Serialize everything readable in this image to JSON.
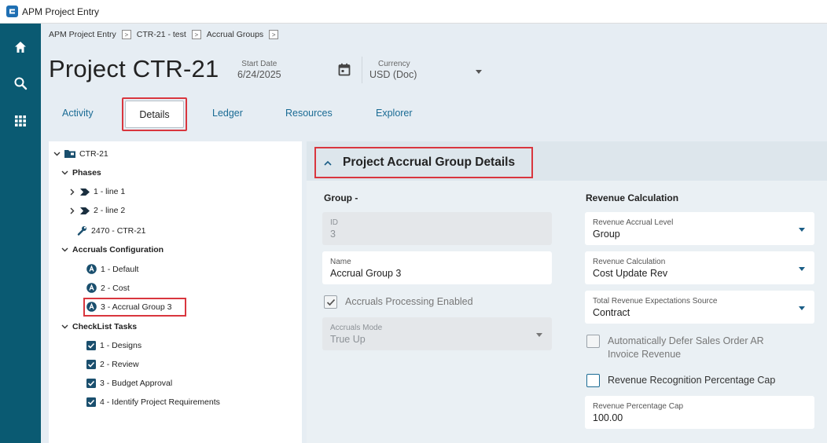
{
  "window": {
    "title": "APM Project Entry"
  },
  "nav": {
    "icons": [
      "home-icon",
      "search-icon",
      "apps-grid-icon"
    ]
  },
  "breadcrumb": [
    "APM Project Entry",
    "CTR-21 - test",
    "Accrual Groups"
  ],
  "page": {
    "title": "Project CTR-21",
    "start_date_label": "Start Date",
    "start_date_value": "6/24/2025",
    "currency_label": "Currency",
    "currency_value": "USD (Doc)"
  },
  "tabs": [
    "Activity",
    "Details",
    "Ledger",
    "Resources",
    "Explorer"
  ],
  "active_tab": "Details",
  "tree": {
    "root": "CTR-21",
    "phases_label": "Phases",
    "phases": [
      "1 - line 1",
      "2 - line 2"
    ],
    "resource": "2470 - CTR-21",
    "accruals_label": "Accruals Configuration",
    "accruals": [
      "1 - Default",
      "2 - Cost",
      "3 - Accrual Group 3"
    ],
    "checklist_label": "CheckList Tasks",
    "checklist": [
      "1 - Designs",
      "2 - Review",
      "3 - Budget Approval",
      "4 - Identify Project Requirements"
    ]
  },
  "details": {
    "header": "Project Accrual Group Details",
    "group_section": "Group -",
    "id_label": "ID",
    "id_value": "3",
    "name_label": "Name",
    "name_value": "Accrual Group 3",
    "accruals_processing_label": "Accruals Processing Enabled",
    "accruals_processing_checked": true,
    "accruals_mode_label": "Accruals Mode",
    "accruals_mode_value": "True Up",
    "revenue_section": "Revenue Calculation",
    "revenue_accrual_level_label": "Revenue Accrual Level",
    "revenue_accrual_level_value": "Group",
    "revenue_calculation_label": "Revenue Calculation",
    "revenue_calculation_value": "Cost Update Rev",
    "total_rev_exp_label": "Total Revenue Expectations Source",
    "total_rev_exp_value": "Contract",
    "auto_defer_line1": "Automatically Defer Sales Order AR",
    "auto_defer_line2": "Invoice Revenue",
    "auto_defer_checked": false,
    "rev_recog_cap_label": "Revenue Recognition Percentage Cap",
    "rev_recog_cap_checked": false,
    "rev_pct_cap_label": "Revenue Percentage Cap",
    "rev_pct_cap_value": "100.00"
  },
  "colors": {
    "nav_rail": "#0a5a72",
    "accent": "#1a6b94",
    "highlight_box": "#d9363e"
  }
}
